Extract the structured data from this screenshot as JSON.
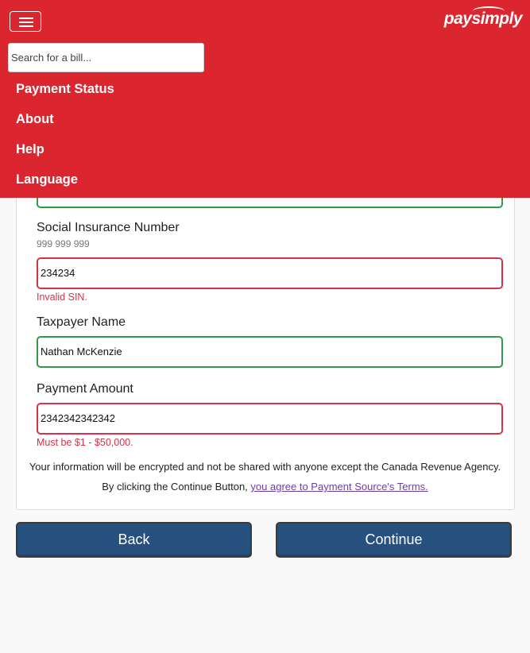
{
  "header": {
    "logo": "paysimply",
    "search": {
      "placeholder": "Search for a bill...",
      "value": ""
    },
    "nav": [
      "Payment Status",
      "About",
      "Help",
      "Language"
    ]
  },
  "form": {
    "sin": {
      "label": "Social Insurance Number",
      "hint": "999 999 999",
      "value": "234234",
      "error": "Invalid SIN."
    },
    "taxpayer_name": {
      "label": "Taxpayer Name",
      "value": "Nathan McKenzie"
    },
    "payment_amount": {
      "label": "Payment Amount",
      "value": "2342342342342",
      "error": "Must be $1 - $50,000."
    },
    "privacy_note": "Your information will be encrypted and not be shared with anyone except the Canada Revenue Agency.",
    "terms_prefix": "By clicking the Continue Button, ",
    "terms_link": "you agree to Payment Source's Terms."
  },
  "buttons": {
    "back": "Back",
    "continue": "Continue"
  },
  "colors": {
    "brand_red": "#dc262f",
    "button_blue": "#26507e",
    "valid_green": "#2e9a4a",
    "error_red": "#d63348",
    "link_purple": "#6a3fa8"
  }
}
